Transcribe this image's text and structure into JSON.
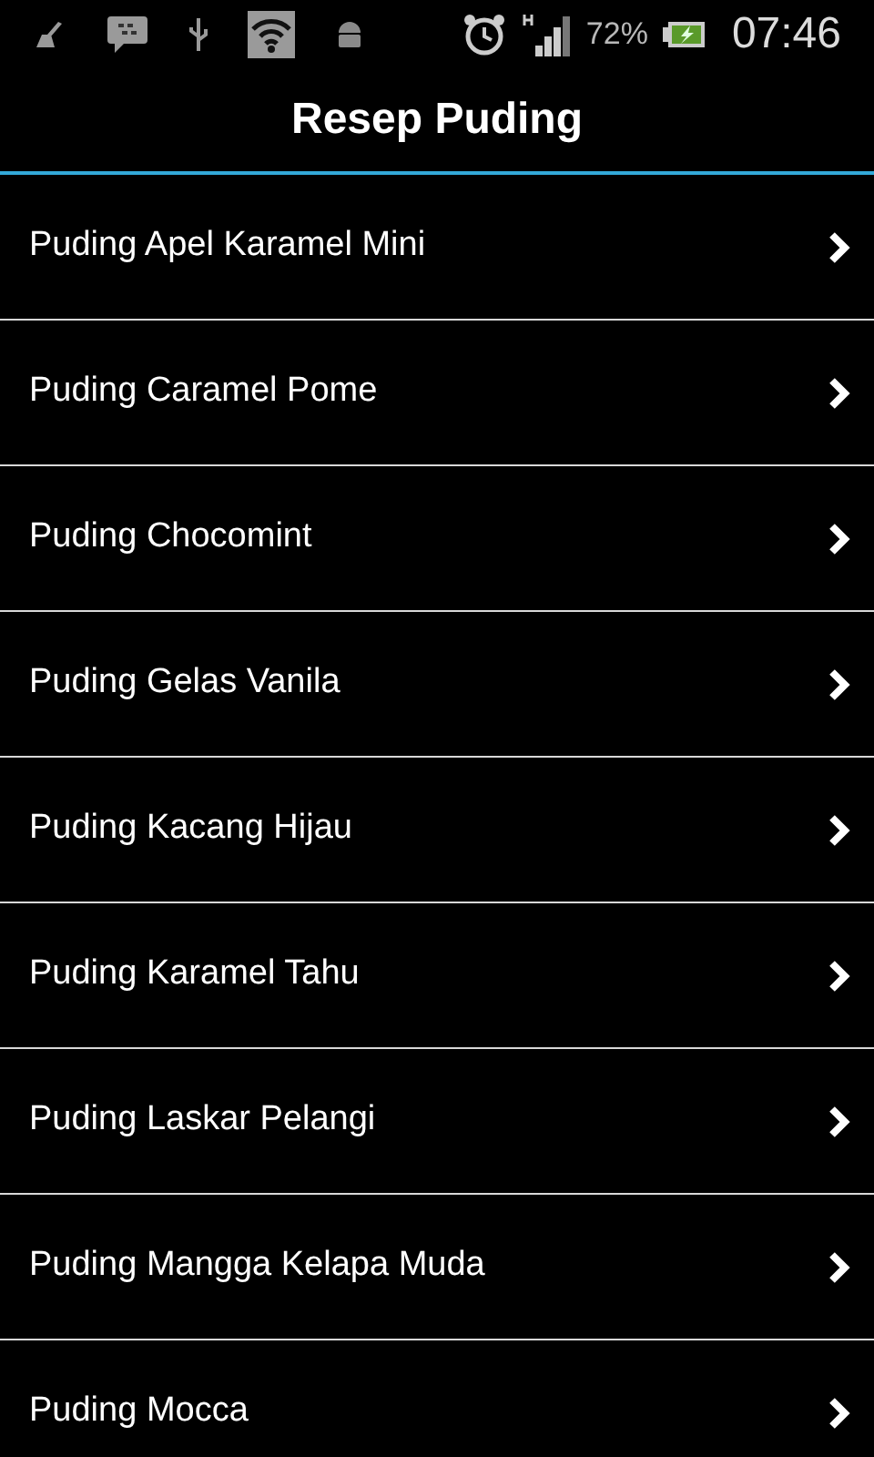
{
  "status_bar": {
    "battery_percent": "72%",
    "time": "07:46"
  },
  "header": {
    "title": "Resep Puding"
  },
  "list": {
    "items": [
      {
        "label": "Puding Apel Karamel Mini"
      },
      {
        "label": "Puding Caramel Pome"
      },
      {
        "label": "Puding Chocomint"
      },
      {
        "label": "Puding Gelas Vanila"
      },
      {
        "label": "Puding Kacang Hijau"
      },
      {
        "label": "Puding Karamel Tahu"
      },
      {
        "label": "Puding Laskar Pelangi"
      },
      {
        "label": "Puding Mangga Kelapa Muda"
      },
      {
        "label": "Puding Mocca"
      }
    ]
  }
}
